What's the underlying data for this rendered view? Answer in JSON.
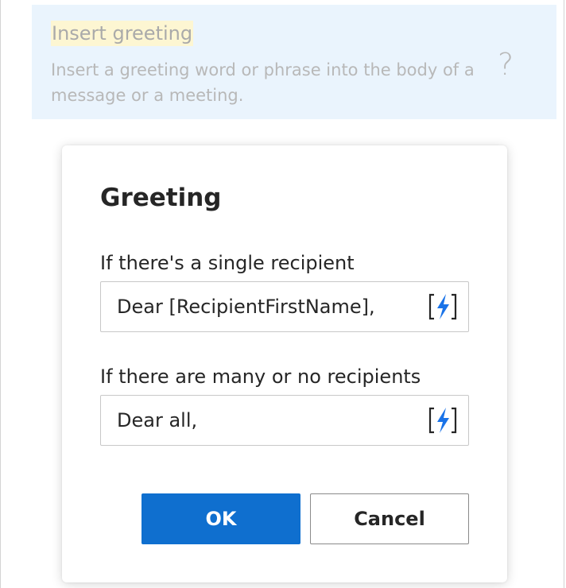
{
  "panel": {
    "title": "Insert greeting",
    "description": "Insert a greeting word or phrase into the body of a message or a meeting.",
    "help_icon_glyph": "?"
  },
  "dialog": {
    "title": "Greeting",
    "fields": [
      {
        "label": "If there's a single recipient",
        "value": "Dear [RecipientFirstName],",
        "icon": "insert-placeholder-bolt-icon"
      },
      {
        "label": "If there are many or no recipients",
        "value": "Dear all,",
        "icon": "insert-placeholder-bolt-icon"
      }
    ],
    "ok_label": "OK",
    "cancel_label": "Cancel"
  },
  "colors": {
    "primary": "#0f6fcf",
    "bolt_icon": "#1a73e8",
    "panel_background": "#eaf4fd",
    "title_highlight": "#fdf6d2"
  }
}
